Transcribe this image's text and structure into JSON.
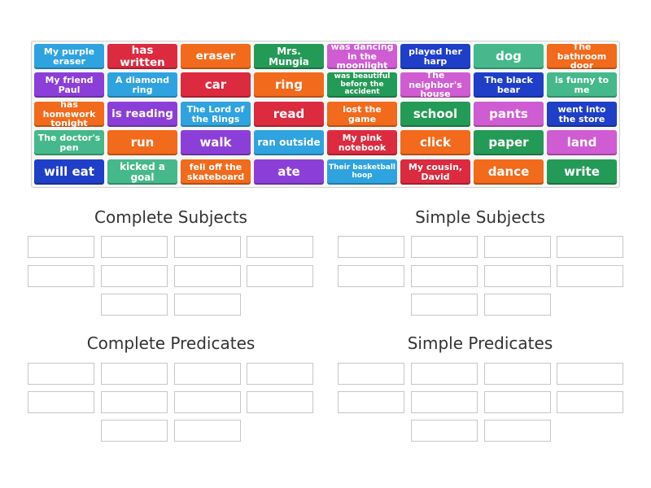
{
  "tiles": [
    {
      "label": "My purple eraser",
      "color": "#2fa3e0"
    },
    {
      "label": "has written",
      "color": "#dc2a3f"
    },
    {
      "label": "eraser",
      "color": "#f26a1b"
    },
    {
      "label": "Mrs. Mungia",
      "color": "#249a57"
    },
    {
      "label": "was dancing in the moonlight",
      "color": "#d05cd3"
    },
    {
      "label": "played her harp",
      "color": "#1f3fc8"
    },
    {
      "label": "dog",
      "color": "#45b98b"
    },
    {
      "label": "The bathroom door",
      "color": "#f26a1b"
    },
    {
      "label": "My friend Paul",
      "color": "#8c3fd8"
    },
    {
      "label": "A diamond ring",
      "color": "#2fa3e0"
    },
    {
      "label": "car",
      "color": "#dc2a3f"
    },
    {
      "label": "ring",
      "color": "#f26a1b"
    },
    {
      "label": "was beautiful before the accident",
      "color": "#249a57"
    },
    {
      "label": "The neighbor's house",
      "color": "#d05cd3"
    },
    {
      "label": "The black bear",
      "color": "#1f3fc8"
    },
    {
      "label": "is funny to me",
      "color": "#45b98b"
    },
    {
      "label": "has homework tonight",
      "color": "#f26a1b"
    },
    {
      "label": "is reading",
      "color": "#8c3fd8"
    },
    {
      "label": "The Lord of the Rings",
      "color": "#2fa3e0"
    },
    {
      "label": "read",
      "color": "#dc2a3f"
    },
    {
      "label": "lost the game",
      "color": "#f26a1b"
    },
    {
      "label": "school",
      "color": "#249a57"
    },
    {
      "label": "pants",
      "color": "#d05cd3"
    },
    {
      "label": "went into the store",
      "color": "#1f3fc8"
    },
    {
      "label": "The doctor's pen",
      "color": "#45b98b"
    },
    {
      "label": "run",
      "color": "#f26a1b"
    },
    {
      "label": "walk",
      "color": "#8c3fd8"
    },
    {
      "label": "ran outside",
      "color": "#2fa3e0"
    },
    {
      "label": "My pink notebook",
      "color": "#dc2a3f"
    },
    {
      "label": "click",
      "color": "#f26a1b"
    },
    {
      "label": "paper",
      "color": "#249a57"
    },
    {
      "label": "land",
      "color": "#d05cd3"
    },
    {
      "label": "will eat",
      "color": "#1f3fc8"
    },
    {
      "label": "kicked a goal",
      "color": "#45b98b"
    },
    {
      "label": "fell off the skateboard",
      "color": "#f26a1b"
    },
    {
      "label": "ate",
      "color": "#8c3fd8"
    },
    {
      "label": "Their basketball hoop",
      "color": "#2fa3e0"
    },
    {
      "label": "My cousin, David",
      "color": "#dc2a3f"
    },
    {
      "label": "dance",
      "color": "#f26a1b"
    },
    {
      "label": "write",
      "color": "#249a57"
    }
  ],
  "groups": [
    {
      "title": "Complete Subjects"
    },
    {
      "title": "Simple Subjects"
    },
    {
      "title": "Complete Predicates"
    },
    {
      "title": "Simple Predicates"
    }
  ]
}
